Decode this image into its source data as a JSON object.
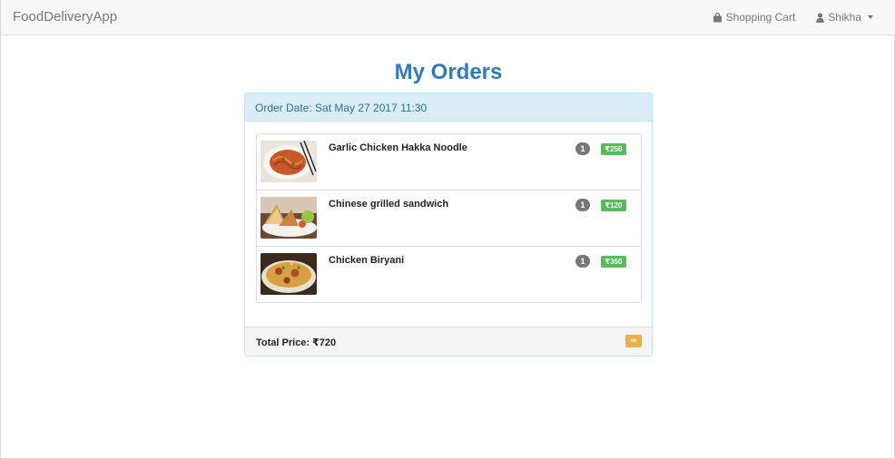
{
  "navbar": {
    "brand": "FoodDeliveryApp",
    "cart_label": "Shopping Cart",
    "user_label": "Shikha"
  },
  "page": {
    "title": "My Orders"
  },
  "order": {
    "date_label": "Order Date: Sat May 27 2017 11:30",
    "items": [
      {
        "name": "Garlic Chicken Hakka Noodle",
        "qty": "1",
        "price": "₹250"
      },
      {
        "name": "Chinese grilled sandwich",
        "qty": "1",
        "price": "₹120"
      },
      {
        "name": "Chicken Biryani",
        "qty": "1",
        "price": "₹350"
      }
    ],
    "total_label": "Total Price: ₹720",
    "status_symbol": "∞"
  },
  "colors": {
    "title": "#337ab7",
    "panel_heading_bg": "#d9edf7",
    "price_label_bg": "#5cb85c",
    "qty_badge_bg": "#777777",
    "status_label_bg": "#f0ad4e"
  },
  "icons": {
    "cart": "shopping-bag-icon",
    "user": "user-icon",
    "dropdown": "caret-down-icon"
  }
}
